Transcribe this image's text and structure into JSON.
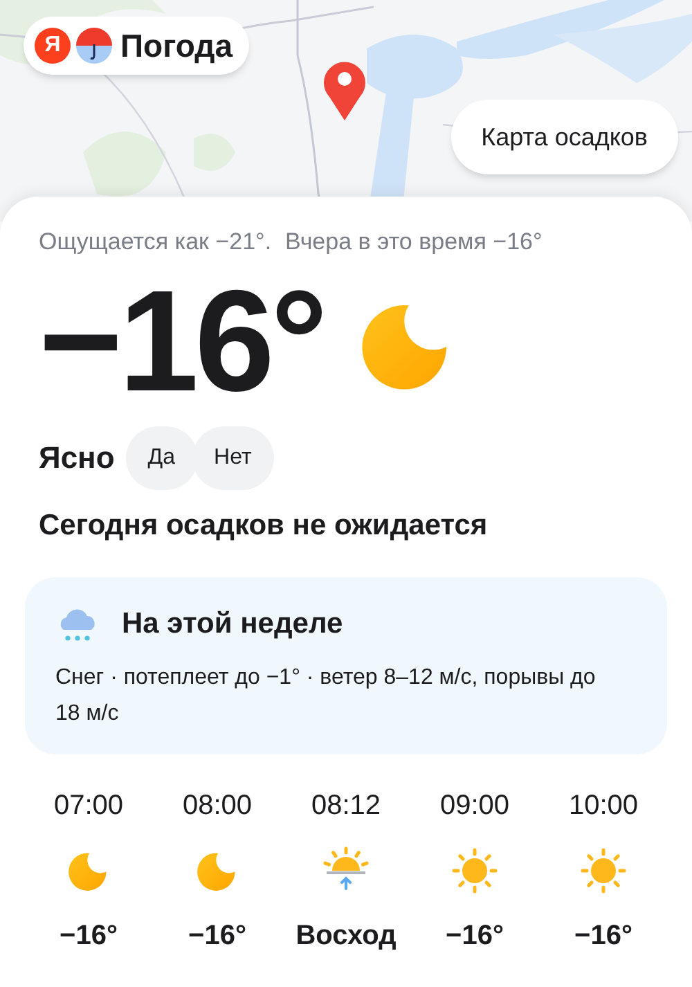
{
  "header": {
    "logo_letter": "Я",
    "app_name": "Погода",
    "map_button": "Карта осадков"
  },
  "current": {
    "feels_like": "Ощущается как −21°.",
    "yesterday": "Вчера в это время −16°",
    "temperature": "−16°",
    "condition": "Ясно",
    "kind": "moon",
    "feedback": [
      "Да",
      "Нет"
    ],
    "precipitation": "Сегодня осадков не ожидается"
  },
  "week": {
    "title": "На этой неделе",
    "text": "Снег · потеплеет до −1° · ветер 8–12 м/с, порывы до 18 м/с"
  },
  "hourly": [
    {
      "time": "07:00",
      "kind": "moon",
      "value": "−16°"
    },
    {
      "time": "08:00",
      "kind": "moon",
      "value": "−16°"
    },
    {
      "time": "08:12",
      "kind": "sunrise",
      "value": "Восход"
    },
    {
      "time": "09:00",
      "kind": "sun",
      "value": "−16°"
    },
    {
      "time": "10:00",
      "kind": "sun",
      "value": "−16°"
    }
  ]
}
